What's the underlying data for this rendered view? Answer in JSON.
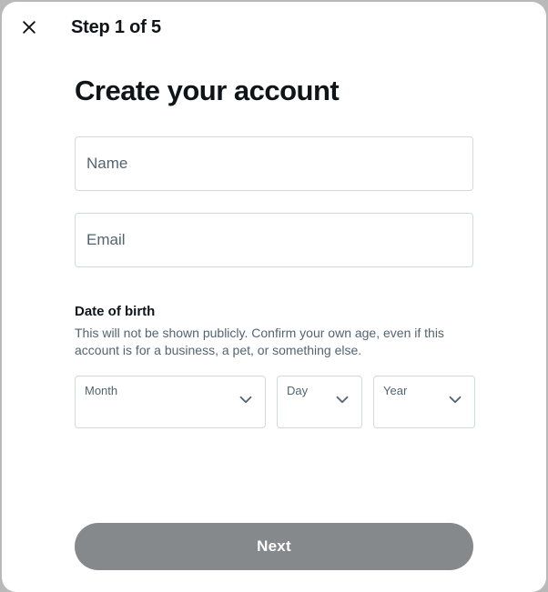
{
  "header": {
    "step_label": "Step 1 of 5"
  },
  "form": {
    "heading": "Create your account",
    "name_placeholder": "Name",
    "email_placeholder": "Email",
    "dob": {
      "title": "Date of birth",
      "description": "This will not be shown publicly. Confirm your own age, even if this account is for a business, a pet, or something else.",
      "month_label": "Month",
      "day_label": "Day",
      "year_label": "Year"
    }
  },
  "footer": {
    "next_label": "Next"
  },
  "colors": {
    "text_primary": "#0f1419",
    "text_secondary": "#536471",
    "border": "#cfd9de",
    "next_bg": "#86898c"
  }
}
